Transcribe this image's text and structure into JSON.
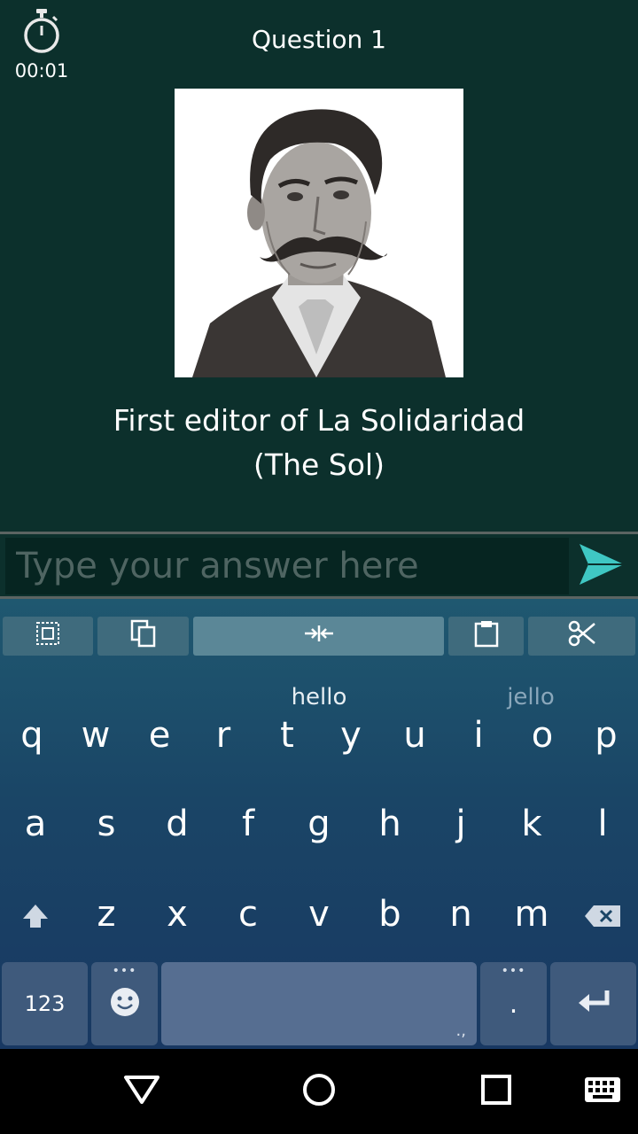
{
  "timer": {
    "icon": "stopwatch-icon",
    "elapsed": "00:01"
  },
  "question": {
    "title": "Question 1",
    "text_line1": "First editor of La Solidaridad",
    "text_line2": "(The Sol)",
    "image": "portrait-engraving"
  },
  "answer": {
    "placeholder": "Type your answer here",
    "value": "",
    "send_icon": "send-icon"
  },
  "keyboard": {
    "toolbar": [
      "select-all-icon",
      "copy-icon",
      "cursor-join-icon",
      "paste-icon",
      "cut-icon"
    ],
    "suggestions": [
      "hello",
      "jello"
    ],
    "row1": [
      "q",
      "w",
      "e",
      "r",
      "t",
      "y",
      "u",
      "i",
      "o",
      "p"
    ],
    "row2": [
      "a",
      "s",
      "d",
      "f",
      "g",
      "h",
      "j",
      "k",
      "l"
    ],
    "row3": [
      "z",
      "x",
      "c",
      "v",
      "b",
      "n",
      "m"
    ],
    "numbers_label": "123",
    "period_label": ".",
    "space_hint": ".,",
    "more_dots": "•••"
  },
  "navbar": {
    "items": [
      "back-icon",
      "home-icon",
      "recents-icon",
      "keyboard-icon"
    ]
  },
  "colors": {
    "background": "#0c302c",
    "send_accent": "#3fc7c3",
    "keyboard_top": "#1f5870",
    "keyboard_bottom": "#183862"
  }
}
